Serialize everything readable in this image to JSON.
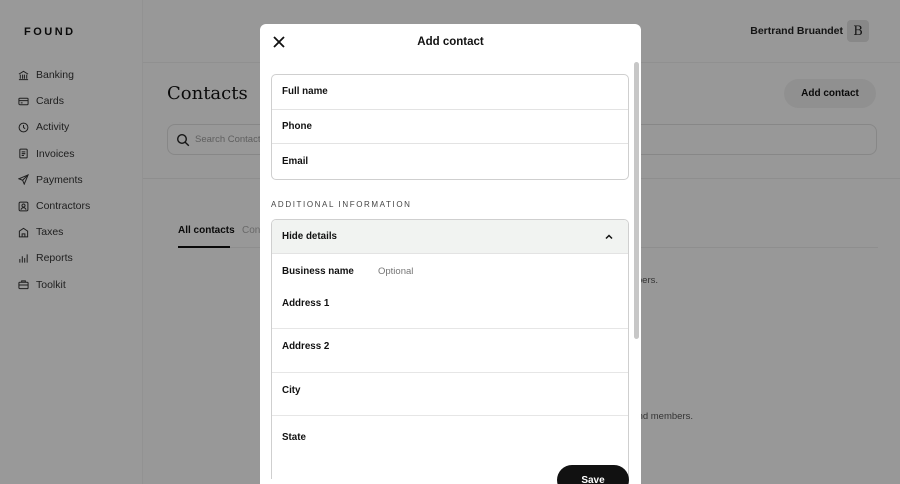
{
  "brand": {
    "logo": "FOUND"
  },
  "sidebar": {
    "items": [
      {
        "label": "Banking",
        "icon": "bank-icon"
      },
      {
        "label": "Cards",
        "icon": "card-icon"
      },
      {
        "label": "Activity",
        "icon": "clock-icon"
      },
      {
        "label": "Invoices",
        "icon": "invoice-icon"
      },
      {
        "label": "Payments",
        "icon": "send-icon"
      },
      {
        "label": "Contractors",
        "icon": "contractor-icon"
      },
      {
        "label": "Taxes",
        "icon": "building-icon"
      },
      {
        "label": "Reports",
        "icon": "bar-chart-icon"
      },
      {
        "label": "Toolkit",
        "icon": "toolkit-icon"
      }
    ]
  },
  "header": {
    "user_name": "Bertrand Bruandet",
    "avatar_initial": "B"
  },
  "main": {
    "title": "Contacts",
    "add_button": "Add contact",
    "search_placeholder": "Search Contacts",
    "tabs": [
      {
        "label": "All contacts"
      },
      {
        "label": "Con"
      }
    ],
    "empty_text_1": "bers.",
    "empty_text_2": "nd members."
  },
  "modal": {
    "title": "Add contact",
    "basic_fields": [
      {
        "label": "Full name"
      },
      {
        "label": "Phone"
      },
      {
        "label": "Email"
      }
    ],
    "section_label": "ADDITIONAL INFORMATION",
    "details_toggle": "Hide details",
    "business_name": {
      "label": "Business name",
      "placeholder": "Optional"
    },
    "address_fields": [
      {
        "label": "Address 1"
      },
      {
        "label": "Address 2"
      },
      {
        "label": "City"
      },
      {
        "label": "State"
      }
    ],
    "save_button": "Save"
  }
}
